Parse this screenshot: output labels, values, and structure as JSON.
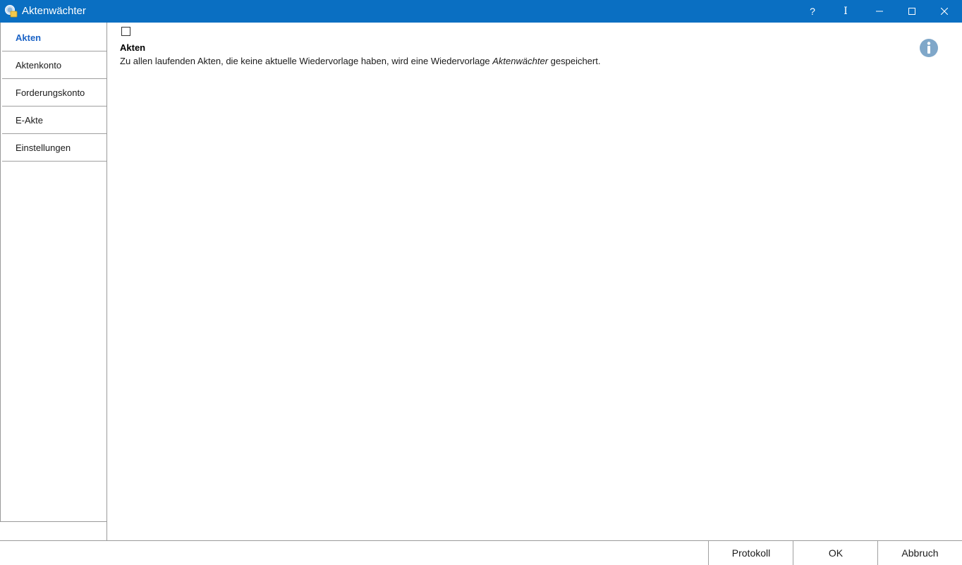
{
  "window": {
    "title": "Aktenwächter",
    "controls": {
      "help": "?",
      "cursor": "I"
    }
  },
  "sidebar": {
    "items": [
      {
        "label": "Akten",
        "active": true
      },
      {
        "label": "Aktenkonto",
        "active": false
      },
      {
        "label": "Forderungskonto",
        "active": false
      },
      {
        "label": "E-Akte",
        "active": false
      },
      {
        "label": "Einstellungen",
        "active": false
      }
    ]
  },
  "main": {
    "checkbox_checked": false,
    "section_title": "Akten",
    "description_before": "Zu allen laufenden Akten, die keine aktuelle Wiedervorlage haben, wird eine Wiedervorlage ",
    "description_italic": "Aktenwächter",
    "description_after": " gespeichert."
  },
  "footer": {
    "protokoll_label": "Protokoll",
    "ok_label": "OK",
    "abbruch_label": "Abbruch"
  },
  "colors": {
    "titlebar": "#0a6fc2",
    "active_nav": "#1b63c6",
    "info_icon": "#7fa7c9"
  },
  "icons": {
    "app": "app-folder-icon",
    "info": "info-icon"
  }
}
